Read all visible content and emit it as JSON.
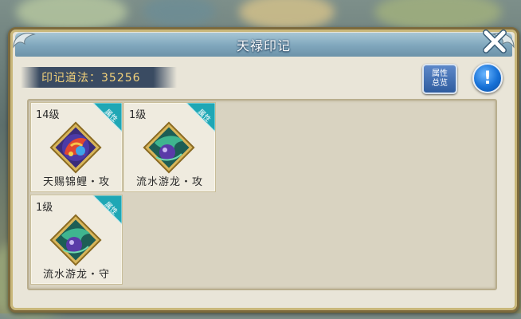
{
  "window": {
    "title": "天禄印记"
  },
  "points": {
    "label": "印记道法：35256"
  },
  "buttons": {
    "overview_line1": "属性",
    "overview_line2": "总览",
    "info": "!"
  },
  "marks": [
    {
      "level": "14级",
      "name": "天赐锦鲤・攻",
      "tag": "属性",
      "icon": "koi-fish-icon"
    },
    {
      "level": "1级",
      "name": "流水游龙・攻",
      "tag": "属性",
      "icon": "green-dragon-icon"
    },
    {
      "level": "1级",
      "name": "流水游龙・守",
      "tag": "属性",
      "icon": "green-dragon-icon"
    }
  ],
  "colors": {
    "title_bar": "#7fa6bc",
    "points_text": "#f3d27a",
    "tag_teal": "#1fa7b5",
    "button_blue": "#2f5c9f"
  }
}
